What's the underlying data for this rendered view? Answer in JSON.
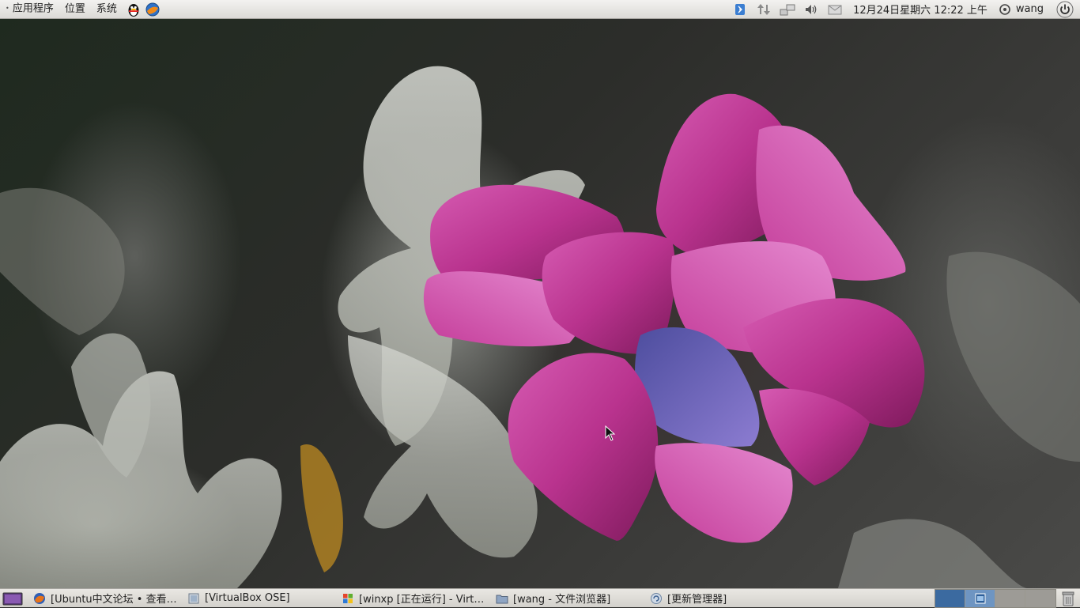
{
  "top_panel": {
    "menus": [
      "应用程序",
      "位置",
      "系统"
    ],
    "launchers": [
      "qq-icon",
      "browser-icon"
    ],
    "tray_icons": [
      "bluetooth-icon",
      "network-transfer-icon",
      "network-manager-icon",
      "volume-icon",
      "mail-icon"
    ],
    "clock": "12月24日星期六 12:22 上午",
    "user_name": "wang"
  },
  "taskbar": {
    "tasks": [
      {
        "label": "[Ubuntu中文论坛 • 查看主题 - ...",
        "icon": "firefox-icon"
      },
      {
        "label": "[VirtualBox OSE]",
        "icon": "virtualbox-icon"
      },
      {
        "label": "[winxp [正在运行] - VirtualBox OSE]",
        "icon": "windows-icon"
      },
      {
        "label": "[wang - 文件浏览器]",
        "icon": "folder-icon"
      },
      {
        "label": "[更新管理器]",
        "icon": "update-icon"
      }
    ],
    "workspace_count": 4
  },
  "colors": {
    "panel": "#e3e1dd",
    "workspace_active": "#3b6aa0",
    "flower": "#b9338e"
  }
}
